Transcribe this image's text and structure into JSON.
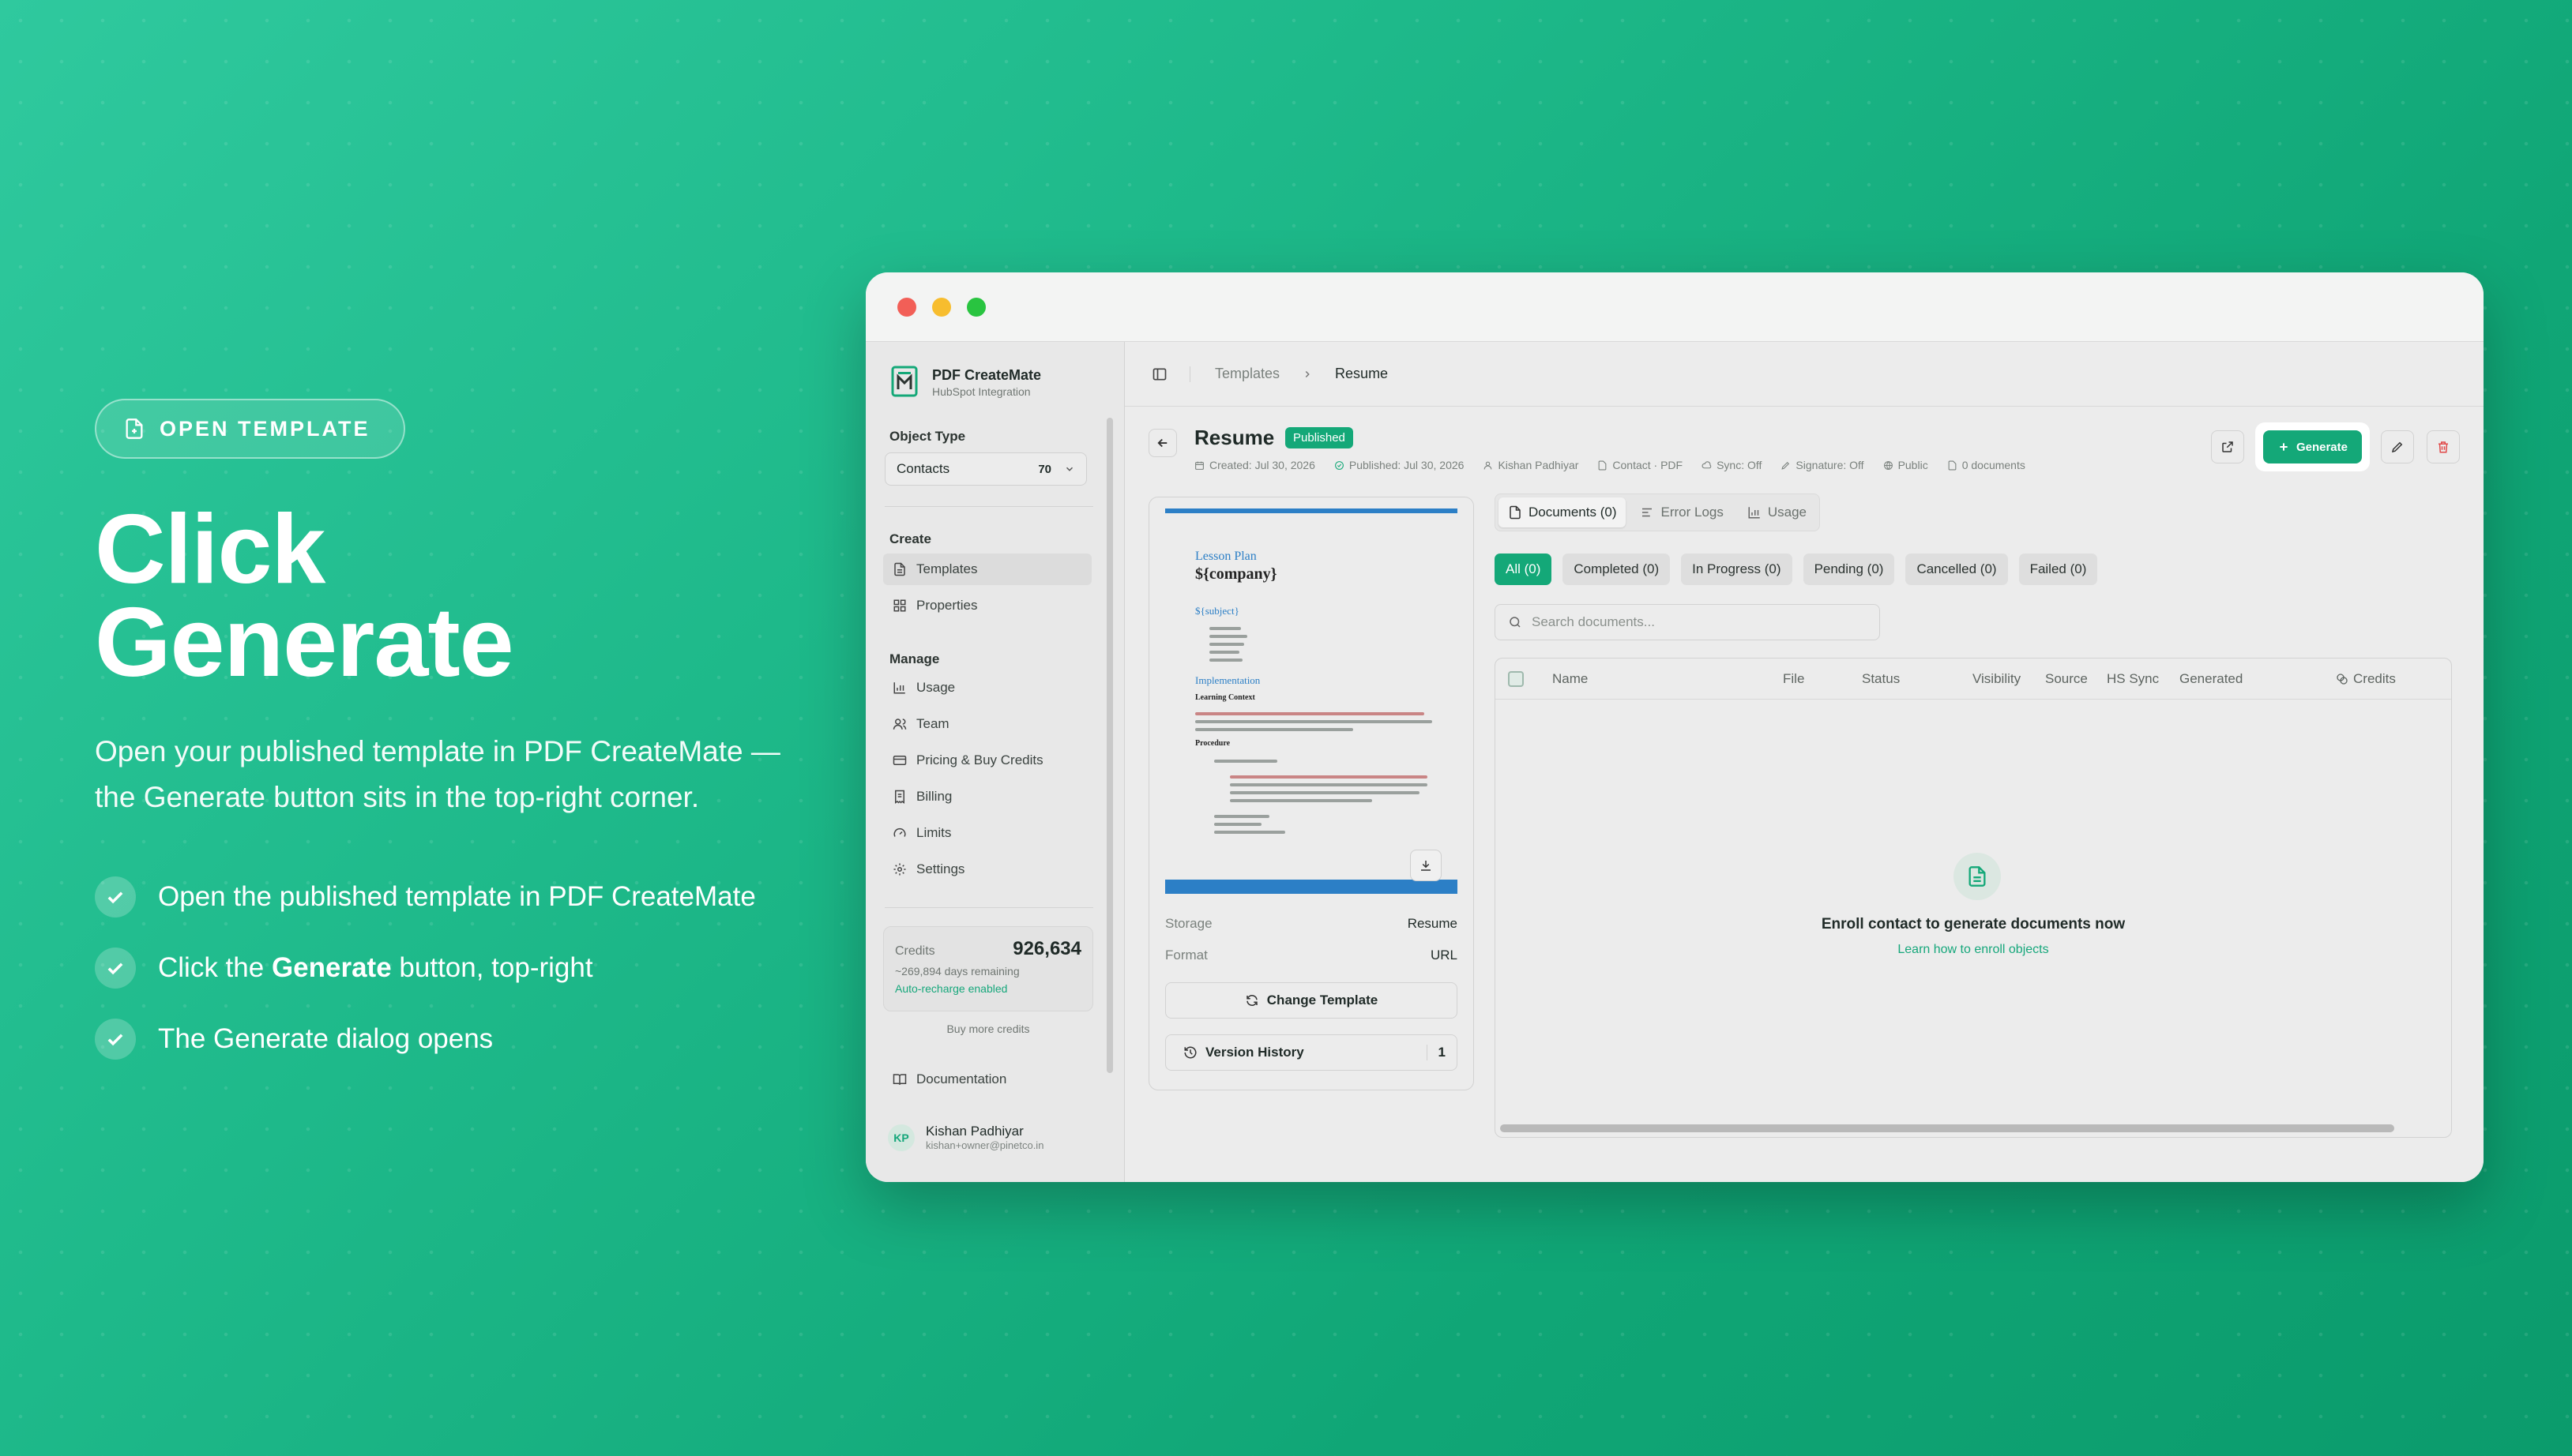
{
  "marketing": {
    "pill_label": "OPEN TEMPLATE",
    "headline_line1": "Click",
    "headline_line2": "Generate",
    "subhead": "Open your published template in PDF CreateMate — the Generate button sits in the top-right corner.",
    "steps": [
      {
        "pre": "Open the published template in PDF CreateMate",
        "bold": "",
        "post": ""
      },
      {
        "pre": "Click the ",
        "bold": "Generate",
        "post": " button, top-right"
      },
      {
        "pre": "The Generate dialog opens",
        "bold": "",
        "post": ""
      }
    ]
  },
  "app": {
    "brand_name": "PDF CreateMate",
    "brand_sub": "HubSpot Integration",
    "object_type_label": "Object Type",
    "object_type_value": "Contacts",
    "object_type_count": "70",
    "create_label": "Create",
    "create_items": [
      "Templates",
      "Properties"
    ],
    "manage_label": "Manage",
    "manage_items": [
      "Usage",
      "Team",
      "Pricing & Buy Credits",
      "Billing",
      "Limits",
      "Settings"
    ],
    "credits_label": "Credits",
    "credits_value": "926,634",
    "credits_days": "~269,894 days remaining",
    "credits_auto": "Auto-recharge enabled",
    "buy_more": "Buy more credits",
    "documentation": "Documentation",
    "user_initials": "KP",
    "user_name": "Kishan Padhiyar",
    "user_email": "kishan+owner@pinetco.in"
  },
  "main": {
    "breadcrumb_parent": "Templates",
    "breadcrumb_current": "Resume",
    "title": "Resume",
    "status_badge": "Published",
    "meta": {
      "created": "Created: Jul 30, 2026",
      "published": "Published: Jul 30, 2026",
      "author": "Kishan Padhiyar",
      "type": "Contact · PDF",
      "sync": "Sync: Off",
      "signature": "Signature: Off",
      "visibility": "Public",
      "documents": "0 documents"
    },
    "generate_label": "Generate",
    "preview": {
      "doc_heading": "Lesson Plan",
      "doc_company": "${company}",
      "doc_subject": "${subject}",
      "doc_impl": "Implementation",
      "doc_learning": "Learning Context",
      "doc_procedure": "Procedure"
    },
    "storage_label": "Storage",
    "storage_value": "Resume",
    "format_label": "Format",
    "format_value": "URL",
    "change_template": "Change Template",
    "version_history": "Version History",
    "version_count": "1",
    "tabs": [
      "Documents (0)",
      "Error Logs",
      "Usage"
    ],
    "filters": [
      "All (0)",
      "Completed (0)",
      "In Progress (0)",
      "Pending (0)",
      "Cancelled (0)",
      "Failed (0)"
    ],
    "search_placeholder": "Search documents...",
    "columns": [
      "Name",
      "File",
      "Status",
      "Visibility",
      "Source",
      "HS Sync",
      "Generated",
      "Credits"
    ],
    "empty_title": "Enroll contact to generate documents now",
    "empty_link": "Learn how to enroll objects"
  },
  "colors": {
    "accent": "#14a878",
    "preview_blue": "#2c7fc6"
  }
}
